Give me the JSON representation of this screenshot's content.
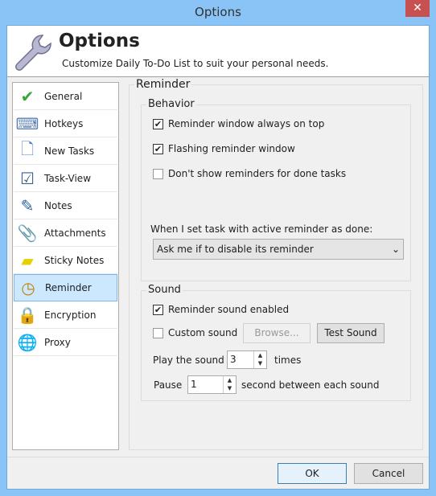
{
  "window": {
    "title": "Options",
    "close": "✕"
  },
  "header": {
    "title": "Options",
    "subtitle": "Customize Daily To-Do List to suit your personal needs."
  },
  "sidebar": {
    "items": [
      {
        "label": "General",
        "icon": "checkmark-icon",
        "glyph": "✔",
        "color": "#3aa53a"
      },
      {
        "label": "Hotkeys",
        "icon": "keyboard-icon",
        "glyph": "⌨",
        "color": "#5a7fb0"
      },
      {
        "label": "New Tasks",
        "icon": "document-icon",
        "glyph": "🗋",
        "color": "#4a7fc0"
      },
      {
        "label": "Task-View",
        "icon": "task-view-icon",
        "glyph": "☑",
        "color": "#3a5f90"
      },
      {
        "label": "Notes",
        "icon": "notes-icon",
        "glyph": "✎",
        "color": "#2a5fa0"
      },
      {
        "label": "Attachments",
        "icon": "paperclip-icon",
        "glyph": "📎",
        "color": "#3a6fb0"
      },
      {
        "label": "Sticky Notes",
        "icon": "sticky-note-icon",
        "glyph": "▰",
        "color": "#e8d000"
      },
      {
        "label": "Reminder",
        "icon": "clock-icon",
        "glyph": "◷",
        "color": "#c08000",
        "selected": true
      },
      {
        "label": "Encryption",
        "icon": "lock-icon",
        "glyph": "🔒",
        "color": "#d0a000"
      },
      {
        "label": "Proxy",
        "icon": "globe-icon",
        "glyph": "🌐",
        "color": "#2070c0"
      }
    ]
  },
  "reminder": {
    "title": "Reminder",
    "behavior": {
      "title": "Behavior",
      "options": [
        {
          "label": "Reminder window always on top",
          "checked": true
        },
        {
          "label": "Flashing reminder window",
          "checked": true
        },
        {
          "label": "Don't show reminders for done tasks",
          "checked": false
        }
      ],
      "done_label": "When I set task with active reminder as done:",
      "done_select": "Ask me if to disable its reminder"
    },
    "sound": {
      "title": "Sound",
      "enabled": {
        "label": "Reminder sound enabled",
        "checked": true
      },
      "custom": {
        "label": "Custom sound",
        "checked": false
      },
      "browse": "Browse...",
      "test": "Test Sound",
      "play_label": "Play the sound",
      "play_value": "3",
      "play_unit": "times",
      "pause_label": "Pause",
      "pause_value": "1",
      "pause_unit": "second between each sound"
    }
  },
  "footer": {
    "ok": "OK",
    "cancel": "Cancel"
  }
}
